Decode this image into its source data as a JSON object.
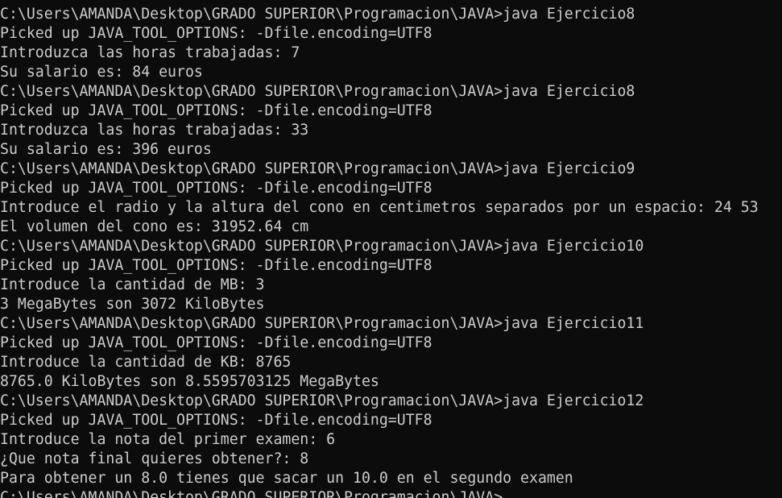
{
  "terminal": {
    "background": "#0c0c0c",
    "foreground": "#cccccc",
    "lines": [
      "C:\\Users\\AMANDA\\Desktop\\GRADO SUPERIOR\\Programacion\\JAVA>java Ejercicio8",
      "Picked up JAVA_TOOL_OPTIONS: -Dfile.encoding=UTF8",
      "Introduzca las horas trabajadas: 7",
      "Su salario es: 84 euros",
      "C:\\Users\\AMANDA\\Desktop\\GRADO SUPERIOR\\Programacion\\JAVA>java Ejercicio8",
      "Picked up JAVA_TOOL_OPTIONS: -Dfile.encoding=UTF8",
      "Introduzca las horas trabajadas: 33",
      "Su salario es: 396 euros",
      "C:\\Users\\AMANDA\\Desktop\\GRADO SUPERIOR\\Programacion\\JAVA>java Ejercicio9",
      "Picked up JAVA_TOOL_OPTIONS: -Dfile.encoding=UTF8",
      "Introduce el radio y la altura del cono en centimetros separados por un espacio: 24 53",
      "El volumen del cono es: 31952.64 cm",
      "C:\\Users\\AMANDA\\Desktop\\GRADO SUPERIOR\\Programacion\\JAVA>java Ejercicio10",
      "Picked up JAVA_TOOL_OPTIONS: -Dfile.encoding=UTF8",
      "Introduce la cantidad de MB: 3",
      "3 MegaBytes son 3072 KiloBytes",
      "C:\\Users\\AMANDA\\Desktop\\GRADO SUPERIOR\\Programacion\\JAVA>java Ejercicio11",
      "Picked up JAVA_TOOL_OPTIONS: -Dfile.encoding=UTF8",
      "Introduce la cantidad de KB: 8765",
      "8765.0 KiloBytes son 8.5595703125 MegaBytes",
      "C:\\Users\\AMANDA\\Desktop\\GRADO SUPERIOR\\Programacion\\JAVA>java Ejercicio12",
      "Picked up JAVA_TOOL_OPTIONS: -Dfile.encoding=UTF8",
      "Introduce la nota del primer examen: 6",
      "¿Que nota final quieres obtener?: 8",
      "Para obtener un 8.0 tienes que sacar un 10.0 en el segundo examen",
      "C:\\Users\\AMANDA\\Desktop\\GRADO SUPERIOR\\Programacion\\JAVA>"
    ]
  }
}
